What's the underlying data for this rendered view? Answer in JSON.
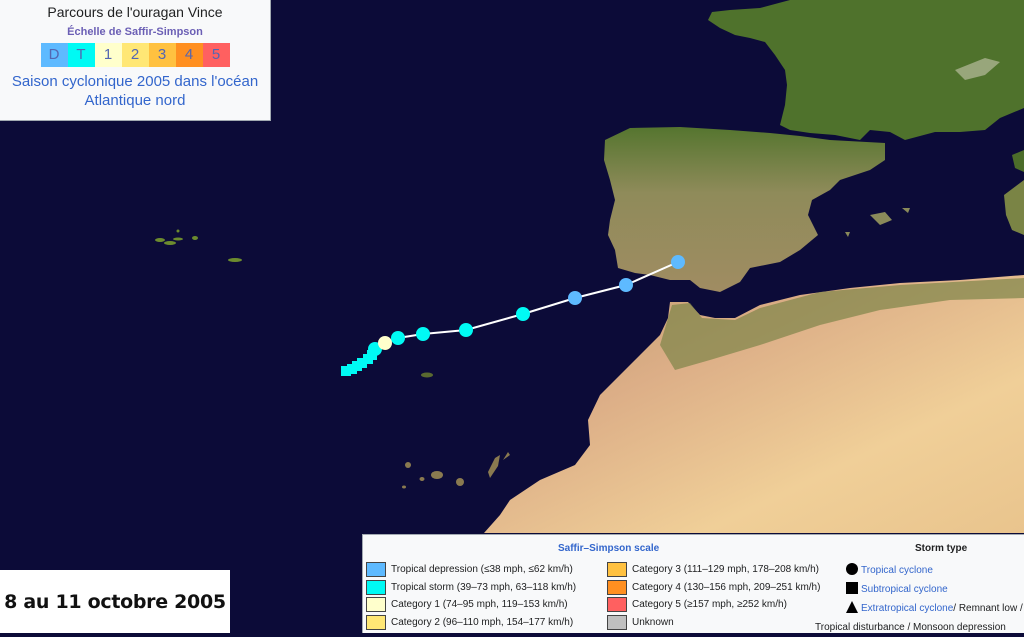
{
  "header": {
    "title": "Parcours de l'ouragan Vince",
    "scale_link": "Échelle de Saffir-Simpson",
    "scale_cells": [
      {
        "label": "D",
        "color": "#5ebaff"
      },
      {
        "label": "T",
        "color": "#00faf4"
      },
      {
        "label": "1",
        "color": "#ffffcc"
      },
      {
        "label": "2",
        "color": "#ffe775"
      },
      {
        "label": "3",
        "color": "#ffc140"
      },
      {
        "label": "4",
        "color": "#ff8f20"
      },
      {
        "label": "5",
        "color": "#ff6060"
      }
    ],
    "season_link": "Saison cyclonique 2005 dans l'océan Atlantique nord"
  },
  "date_label": "8 au 11 octobre 2005",
  "legend": {
    "scale_title": "Saffir–Simpson scale",
    "scale_items": [
      {
        "label": "Tropical depression (≤38 mph, ≤62 km/h)",
        "color": "#5ebaff"
      },
      {
        "label": "Tropical storm (39–73 mph, 63–118 km/h)",
        "color": "#00faf4"
      },
      {
        "label": "Category 1 (74–95 mph, 119–153 km/h)",
        "color": "#ffffcc"
      },
      {
        "label": "Category 2 (96–110 mph, 154–177 km/h)",
        "color": "#ffe775"
      },
      {
        "label": "Category 3 (111–129 mph, 178–208 km/h)",
        "color": "#ffc140"
      },
      {
        "label": "Category 4 (130–156 mph, 209–251 km/h)",
        "color": "#ff8f20"
      },
      {
        "label": "Category 5 (≥157 mph, ≥252 km/h)",
        "color": "#ff6060"
      },
      {
        "label": "Unknown",
        "color": "#c0c0c0"
      }
    ],
    "type_title": "Storm type",
    "type_items": [
      {
        "shape": "circle-icon",
        "link": "Tropical cyclone",
        "rest": ""
      },
      {
        "shape": "square-icon",
        "link": "Subtropical cyclone",
        "rest": ""
      },
      {
        "shape": "triangle-icon",
        "link": "Extratropical cyclone",
        "rest": " / Remnant low /"
      }
    ],
    "type_continuation": "Tropical disturbance / Monsoon depression"
  },
  "track": {
    "line_color": "#ffffff",
    "points": [
      {
        "type": "subtropical",
        "category": "T"
      },
      {
        "type": "subtropical",
        "category": "T"
      },
      {
        "type": "subtropical",
        "category": "T"
      },
      {
        "type": "subtropical",
        "category": "T"
      },
      {
        "type": "subtropical",
        "category": "T"
      },
      {
        "type": "subtropical",
        "category": "T"
      },
      {
        "type": "tropical",
        "category": "T"
      },
      {
        "type": "tropical",
        "category": "1"
      },
      {
        "type": "tropical",
        "category": "T"
      },
      {
        "type": "tropical",
        "category": "T"
      },
      {
        "type": "tropical",
        "category": "T"
      },
      {
        "type": "tropical",
        "category": "T"
      },
      {
        "type": "tropical",
        "category": "D"
      },
      {
        "type": "tropical",
        "category": "D"
      },
      {
        "type": "tropical",
        "category": "D"
      }
    ]
  },
  "colors": {
    "ocean": "#0c0b38",
    "land_green": "#5a7a35",
    "land_desert": "#e6b98a"
  }
}
